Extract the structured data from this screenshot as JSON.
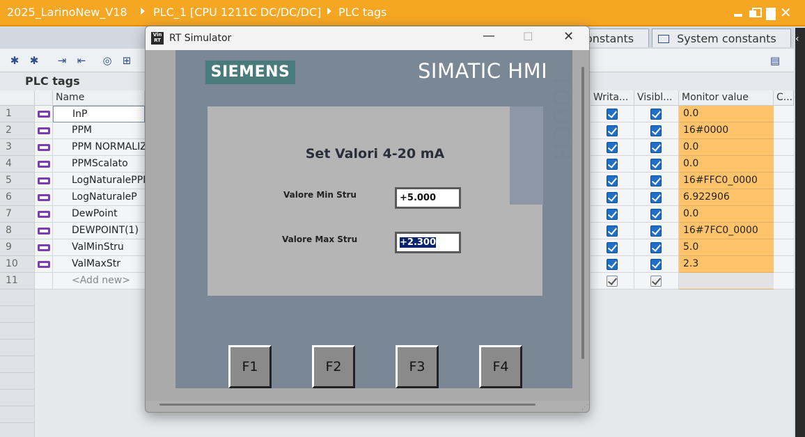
{
  "titlebar": {
    "project": "2025_LarinoNew_V18",
    "device": "PLC_1 [CPU 1211C DC/DC/DC]",
    "section": "PLC tags"
  },
  "tabs": {
    "constants_partial": "onstants",
    "system_constants": "System constants"
  },
  "panel_title": "PLC tags",
  "columns": {
    "name": "Name",
    "writable": "Writa...",
    "visible": "Visibl...",
    "monitor": "Monitor value",
    "comment": "C..."
  },
  "rows": [
    {
      "num": "1",
      "name": "InP",
      "monitor": "0.0"
    },
    {
      "num": "2",
      "name": "PPM",
      "monitor": "16#0000"
    },
    {
      "num": "3",
      "name": "PPM NORMALIZZ",
      "monitor": "0.0"
    },
    {
      "num": "4",
      "name": "PPMScalato",
      "monitor": "0.0"
    },
    {
      "num": "5",
      "name": "LogNaturalePPM",
      "monitor": "16#FFC0_0000"
    },
    {
      "num": "6",
      "name": "LogNaturaleP",
      "monitor": "6.922906"
    },
    {
      "num": "7",
      "name": "DewPoint",
      "monitor": "0.0"
    },
    {
      "num": "8",
      "name": "DEWPOINT(1)",
      "monitor": "16#7FC0_0000"
    },
    {
      "num": "9",
      "name": "ValMinStru",
      "monitor": "5.0"
    },
    {
      "num": "10",
      "name": "ValMaxStr",
      "monitor": "2.3"
    }
  ],
  "add_row": {
    "num": "11",
    "name": "<Add new>"
  },
  "simulator": {
    "title": "RT Simulator",
    "logo_text": "Win CC RT",
    "brand": "SIEMENS",
    "product": "SIMATIC HMI",
    "touch": "TOUCH",
    "screen_title": "Set Valori 4-20 mA",
    "min_label": "Valore Min Stru",
    "min_value": "+5.000",
    "max_label": "Valore Max Stru",
    "max_value": "+2.300",
    "fkeys": [
      "F1",
      "F2",
      "F3",
      "F4"
    ]
  },
  "colors": {
    "title_bar": "#f5a623",
    "monitor_cell": "#ffc46b",
    "checkbox": "#1f6fc8",
    "siemens_logo": "#4a7b7b",
    "hmi_panel": "#7a8795"
  }
}
